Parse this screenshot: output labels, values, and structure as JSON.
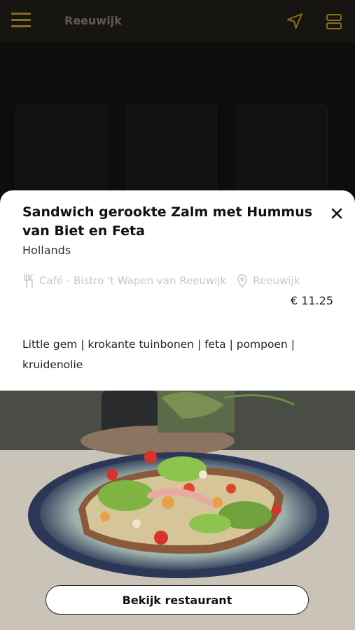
{
  "header": {
    "title": "Reeuwijk",
    "menu_icon": "hamburger-icon",
    "location_icon": "navigation-arrow-icon",
    "view_icon": "list-view-icon",
    "accent_color": "#8a6d1a"
  },
  "dish": {
    "title": "Sandwich gerookte Zalm met Hummus van Biet en Feta",
    "cuisine": "Hollands",
    "restaurant": "Café - Bistro 't Wapen van Reeuwijk",
    "location": "Reeuwijk",
    "price": "€ 11.25",
    "description": "Little gem | krokante tuinbonen | feta | pompoen | kruidenolie"
  },
  "actions": {
    "close_icon": "close-icon",
    "view_restaurant_label": "Bekijk restaurant"
  }
}
